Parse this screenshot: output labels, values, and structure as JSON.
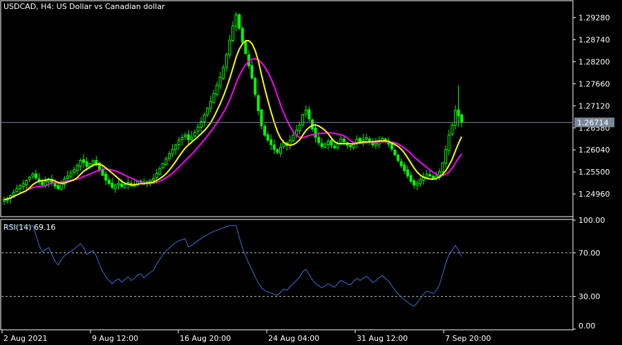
{
  "window_title": "USDCAD, H4:  US Dollar vs Canadian dollar",
  "colors": {
    "background": "#000000",
    "candle": "#00ff00",
    "ma_fast": "#ffff00",
    "ma_slow": "#ff00ff",
    "rsi": "#3b6fd6",
    "price_line": "#778899",
    "price_tag_bg": "#778899"
  },
  "current_price_label": "1.26714",
  "rsi_label": "RSI(14) 69.16",
  "chart_data": [
    {
      "type": "candlestick",
      "title": "USDCAD, H4:  US Dollar vs Canadian dollar",
      "ylim": [
        1.2442,
        1.2968
      ],
      "y_ticks": [
        "1.29280",
        "1.28740",
        "1.28200",
        "1.27660",
        "1.27120",
        "1.26580",
        "1.26040",
        "1.25500",
        "1.24960"
      ],
      "y_tick_values": [
        1.2928,
        1.2874,
        1.282,
        1.2766,
        1.2712,
        1.2658,
        1.2604,
        1.255,
        1.2496
      ],
      "current_price": 1.26714,
      "close_series": [
        1.2482,
        1.2485,
        1.2492,
        1.25,
        1.2509,
        1.2516,
        1.2521,
        1.2529,
        1.2537,
        1.2545,
        1.2535,
        1.2526,
        1.2519,
        1.2527,
        1.2533,
        1.2524,
        1.2515,
        1.2509,
        1.2522,
        1.2533,
        1.254,
        1.2547,
        1.2555,
        1.2566,
        1.2578,
        1.2573,
        1.2563,
        1.257,
        1.2577,
        1.2569,
        1.2555,
        1.2542,
        1.253,
        1.2521,
        1.2512,
        1.2518,
        1.2522,
        1.2514,
        1.2519,
        1.2524,
        1.2516,
        1.252,
        1.2526,
        1.2528,
        1.2521,
        1.2526,
        1.253,
        1.2534,
        1.2546,
        1.2558,
        1.257,
        1.2582,
        1.2594,
        1.2605,
        1.2616,
        1.2628,
        1.2634,
        1.264,
        1.2629,
        1.2636,
        1.2647,
        1.266,
        1.2673,
        1.2689,
        1.2706,
        1.2723,
        1.2742,
        1.2763,
        1.2782,
        1.2806,
        1.2838,
        1.2873,
        1.2908,
        1.2935,
        1.2902,
        1.2868,
        1.284,
        1.281,
        1.278,
        1.274,
        1.27,
        1.2663,
        1.264,
        1.2628,
        1.2617,
        1.2605,
        1.2598,
        1.261,
        1.2622,
        1.2615,
        1.2628,
        1.264,
        1.2652,
        1.2665,
        1.269,
        1.2702,
        1.268,
        1.2655,
        1.2635,
        1.2622,
        1.2612,
        1.2618,
        1.2625,
        1.2616,
        1.2609,
        1.262,
        1.263,
        1.2624,
        1.2615,
        1.2612,
        1.2622,
        1.263,
        1.2623,
        1.2629,
        1.2634,
        1.2626,
        1.2616,
        1.262,
        1.2627,
        1.2632,
        1.2625,
        1.2618,
        1.2606,
        1.2592,
        1.2578,
        1.2565,
        1.2553,
        1.254,
        1.2527,
        1.2518,
        1.2523,
        1.2531,
        1.2538,
        1.2544,
        1.254,
        1.2535,
        1.254,
        1.255,
        1.2572,
        1.2605,
        1.264,
        1.2665,
        1.27,
        1.2688,
        1.2671
      ]
    },
    {
      "type": "line",
      "title": "RSI(14) 69.16",
      "ylim": [
        0,
        100
      ],
      "y_ticks": [
        "100.00",
        "70.00",
        "30.00",
        "0.00"
      ],
      "levels": [
        70,
        30
      ],
      "x_tick_labels": [
        "2 Aug 2021",
        "9 Aug 12:00",
        "16 Aug 20:00",
        "24 Aug 04:00",
        "31 Aug 12:00",
        "7 Sep 20:00"
      ],
      "last_value": 69.16
    }
  ]
}
